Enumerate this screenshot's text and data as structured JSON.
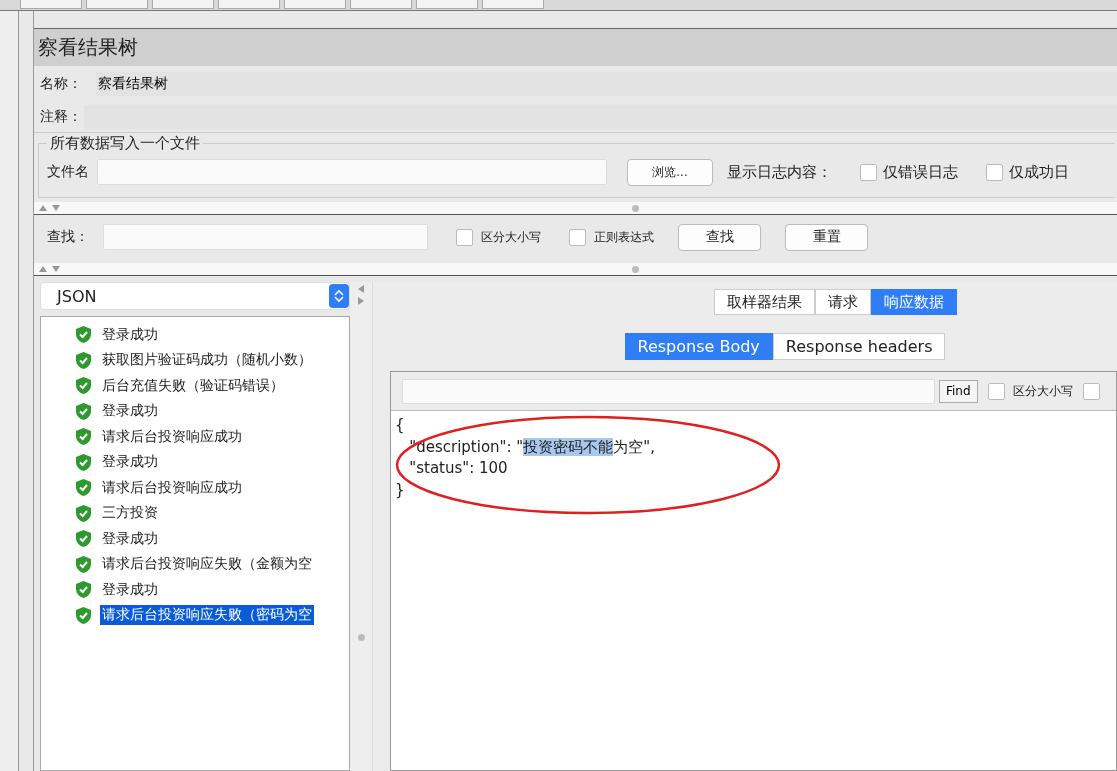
{
  "window": {
    "title": "察看结果树"
  },
  "name_field": {
    "label": "名称：",
    "value": "察看结果树"
  },
  "comment_field": {
    "label": "注释："
  },
  "file_group": {
    "title": "所有数据写入一个文件",
    "file_label": "文件名",
    "browse_button": "浏览...",
    "log_label": "显示日志内容：",
    "options": [
      {
        "label": "仅错误日志",
        "checked": false
      },
      {
        "label": "仅成功日",
        "checked": false
      }
    ]
  },
  "search": {
    "label": "查找：",
    "options": [
      {
        "label": "区分大小写",
        "checked": false
      },
      {
        "label": "正则表达式",
        "checked": false
      }
    ],
    "buttons": [
      "查找",
      "重置"
    ]
  },
  "renderer": {
    "value": "JSON"
  },
  "results": [
    {
      "label": "登录成功",
      "passed": true,
      "selected": false
    },
    {
      "label": "获取图片验证码成功（随机小数）",
      "passed": true,
      "selected": false
    },
    {
      "label": "后台充值失败（验证码错误）",
      "passed": true,
      "selected": false
    },
    {
      "label": "登录成功",
      "passed": true,
      "selected": false
    },
    {
      "label": "请求后台投资响应成功",
      "passed": true,
      "selected": false
    },
    {
      "label": "登录成功",
      "passed": true,
      "selected": false
    },
    {
      "label": "请求后台投资响应成功",
      "passed": true,
      "selected": false
    },
    {
      "label": "三方投资",
      "passed": true,
      "selected": false
    },
    {
      "label": "登录成功",
      "passed": true,
      "selected": false
    },
    {
      "label": "请求后台投资响应失败（金额为空",
      "passed": true,
      "selected": false
    },
    {
      "label": "登录成功",
      "passed": true,
      "selected": false
    },
    {
      "label": "请求后台投资响应失败（密码为空",
      "passed": true,
      "selected": true
    }
  ],
  "tabs": [
    {
      "label": "取样器结果",
      "selected": false
    },
    {
      "label": "请求",
      "selected": false
    },
    {
      "label": "响应数据",
      "selected": true
    }
  ],
  "subtabs": [
    {
      "label": "Response Body",
      "selected": true
    },
    {
      "label": "Response headers",
      "selected": false
    }
  ],
  "response": {
    "find_button": "Find",
    "options": [
      {
        "label": "区分大小写",
        "checked": false
      },
      {
        "checked": false
      }
    ],
    "lines": [
      {
        "segments": [
          {
            "text": "{",
            "selected": false
          }
        ]
      },
      {
        "segments": [
          {
            "text": "   \"description\": \"",
            "selected": false
          },
          {
            "text": "投资密码不能",
            "selected": true
          },
          {
            "text": "为空\",",
            "selected": false
          }
        ]
      },
      {
        "segments": [
          {
            "text": "   \"status\": 100",
            "selected": false
          }
        ]
      },
      {
        "segments": [
          {
            "text": "}",
            "selected": false
          }
        ]
      }
    ]
  }
}
